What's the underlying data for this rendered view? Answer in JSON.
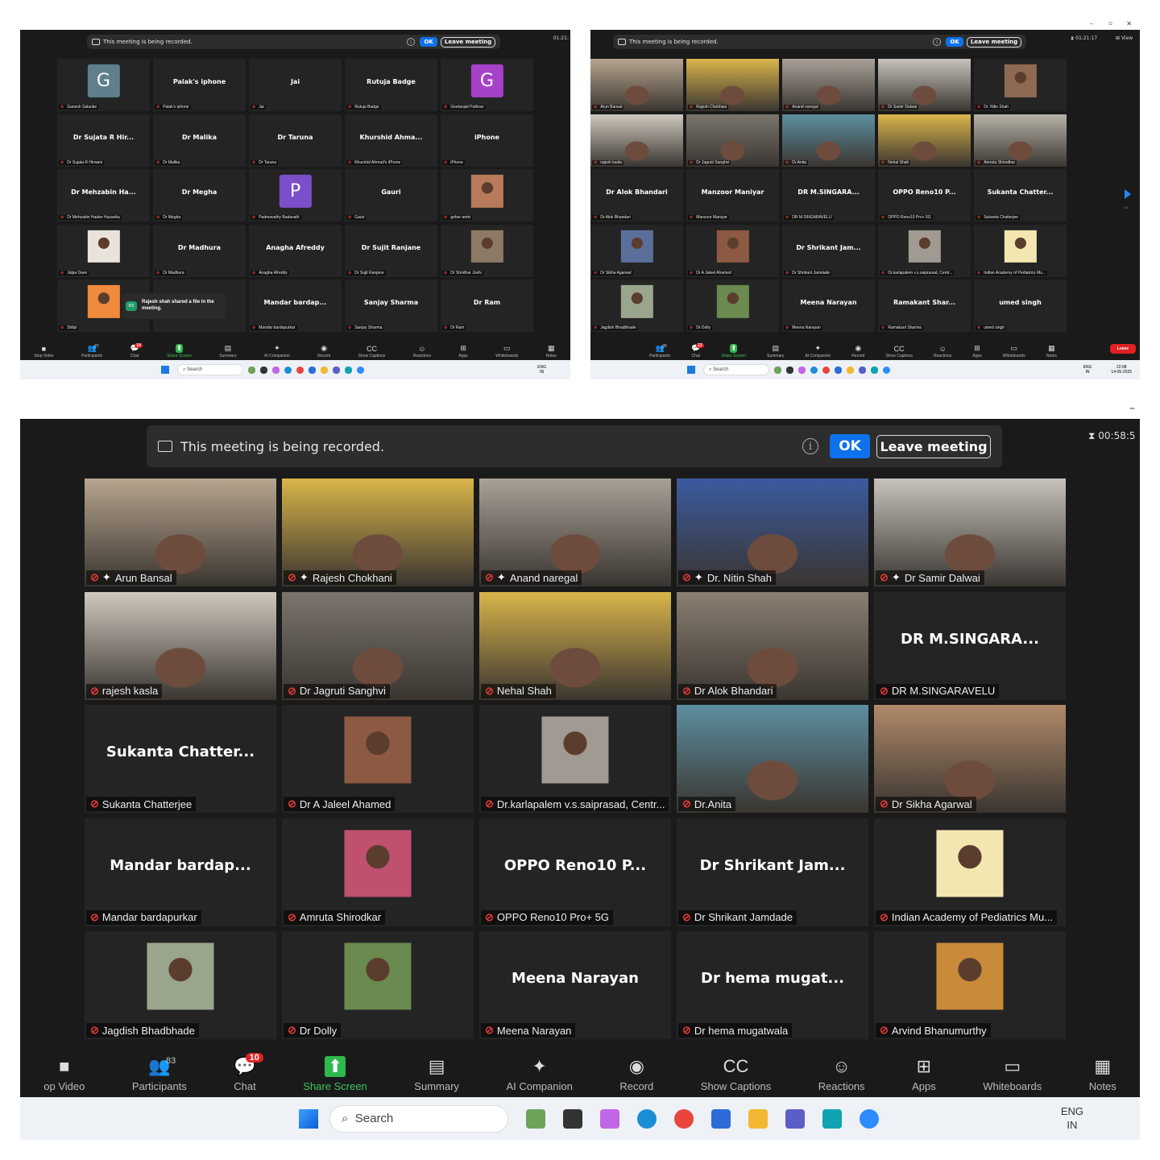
{
  "recording": {
    "message": "This meeting is being recorded.",
    "ok_label": "OK",
    "leave_label": "Leave meeting"
  },
  "screens": {
    "top_left": {
      "timer": "01:21:",
      "tiles": [
        {
          "kind": "avatar",
          "letter": "G",
          "color": "#5f7f8c",
          "name": "Ganesh Salunke"
        },
        {
          "kind": "text",
          "display": "Palak's iphone",
          "name": "Palak's iphone"
        },
        {
          "kind": "text",
          "display": "Jai",
          "name": "Jai"
        },
        {
          "kind": "text",
          "display": "Rutuja Badge",
          "name": "Rutuja Badge"
        },
        {
          "kind": "avatar",
          "letter": "G",
          "color": "#a542c8",
          "name": "Geetanjali Puthran"
        },
        {
          "kind": "text",
          "display": "Dr Sujata R Hir...",
          "name": "Dr Sujata R Hirwani"
        },
        {
          "kind": "text",
          "display": "Dr Malika",
          "name": "Dr Malika"
        },
        {
          "kind": "text",
          "display": "Dr Taruna",
          "name": "Dr Taruna"
        },
        {
          "kind": "text",
          "display": "Khurshid Ahma...",
          "name": "Khurshid Ahmad's iPhone"
        },
        {
          "kind": "text",
          "display": "iPhone",
          "name": "iPhone"
        },
        {
          "kind": "text",
          "display": "Dr Mehzabin Ha...",
          "name": "Dr Mehzabin Haider Hazarika"
        },
        {
          "kind": "text",
          "display": "Dr Megha",
          "name": "Dr Megha"
        },
        {
          "kind": "avatar",
          "letter": "P",
          "color": "#7b4fc9",
          "name": "Padmavathy Badavath"
        },
        {
          "kind": "text",
          "display": "Gauri",
          "name": "Gauri"
        },
        {
          "kind": "photo",
          "color": "#b87a5a",
          "name": "gohar amin"
        },
        {
          "kind": "photo",
          "color": "#e9e3dc",
          "name": "Jalpa Dave"
        },
        {
          "kind": "text",
          "display": "Dr Madhura",
          "name": "Dr Madhura"
        },
        {
          "kind": "text",
          "display": "Anagha Afreddy",
          "name": "Anagha Afreddy"
        },
        {
          "kind": "text",
          "display": "Dr Sujit Ranjane",
          "name": "Dr Sujit Ranjane"
        },
        {
          "kind": "photo",
          "color": "#8d7a66",
          "name": "Dr Shridhar Joshi"
        },
        {
          "kind": "photo",
          "color": "#f08a3c",
          "name": "Shilpi"
        },
        {
          "kind": "text",
          "display": "ll",
          "name": ""
        },
        {
          "kind": "text",
          "display": "Mandar bardap...",
          "name": "Mandar bardapurkar"
        },
        {
          "kind": "text",
          "display": "Sanjay Sharma",
          "name": "Sanjay Sharma"
        },
        {
          "kind": "text",
          "display": "Dr Ram",
          "name": "Dr Ram"
        }
      ],
      "toast": {
        "initials": "RS",
        "text": "Rajesh shah shared a file in the meeting."
      },
      "toolbar": [
        {
          "label": "Stop Video",
          "icon": "video-icon"
        },
        {
          "label": "Participants",
          "icon": "participants-icon",
          "count": "97"
        },
        {
          "label": "Chat",
          "icon": "chat-icon",
          "badge": "14"
        },
        {
          "label": "Share Screen",
          "icon": "share-screen-icon",
          "green": true
        },
        {
          "label": "Summary",
          "icon": "summary-icon"
        },
        {
          "label": "AI Companion",
          "icon": "ai-companion-icon"
        },
        {
          "label": "Record",
          "icon": "record-icon"
        },
        {
          "label": "Show Captions",
          "icon": "captions-icon"
        },
        {
          "label": "Reactions",
          "icon": "reactions-icon"
        },
        {
          "label": "Apps",
          "icon": "apps-icon"
        },
        {
          "label": "Whiteboards",
          "icon": "whiteboards-icon"
        },
        {
          "label": "Notes",
          "icon": "notes-icon"
        }
      ],
      "taskbar": {
        "search": "Search",
        "lang1": "ENG",
        "lang2": "IN"
      }
    },
    "top_right": {
      "timer": "01:21:17",
      "view_label": "View",
      "page_indicator": "1/4",
      "tiles": [
        {
          "kind": "video",
          "color": "#b7a58f",
          "name": "Arun Bansal"
        },
        {
          "kind": "video",
          "color": "#d9b54a",
          "name": "Rajesh Chokhani"
        },
        {
          "kind": "video",
          "color": "#a9a198",
          "name": "Anand naregal"
        },
        {
          "kind": "video",
          "color": "#c7c3bc",
          "name": "Dr Samir Dalwai"
        },
        {
          "kind": "photo",
          "color": "#8f6a52",
          "name": "Dr. Nitin Shah"
        },
        {
          "kind": "video",
          "color": "#cfc8be",
          "name": "rajesh kasla"
        },
        {
          "kind": "video",
          "color": "#7b756d",
          "name": "Dr Jagruti Sanghvi"
        },
        {
          "kind": "video",
          "color": "#5d8fa0",
          "name": "Dr.Anita"
        },
        {
          "kind": "video",
          "color": "#d9b54a",
          "name": "Nehal Shah"
        },
        {
          "kind": "video",
          "color": "#b8b3a8",
          "name": "Amruta Shirodkar"
        },
        {
          "kind": "text",
          "display": "Dr Alok Bhandari",
          "name": "Dr Alok Bhandari"
        },
        {
          "kind": "text",
          "display": "Manzoor Maniyar",
          "name": "Manzoor Maniyar"
        },
        {
          "kind": "text",
          "display": "DR M.SINGARA...",
          "name": "DR M.SINGARAVELU"
        },
        {
          "kind": "text",
          "display": "OPPO Reno10 P...",
          "name": "OPPO Reno10 Pro+ 5G"
        },
        {
          "kind": "text",
          "display": "Sukanta Chatter...",
          "name": "Sukanta Chatterjee"
        },
        {
          "kind": "photo",
          "color": "#5a6f9a",
          "name": "Dr Sikha Agarwal"
        },
        {
          "kind": "photo",
          "color": "#8c5a42",
          "name": "Dr A Jaleel Ahamed"
        },
        {
          "kind": "text",
          "display": "Dr Shrikant Jam...",
          "name": "Dr Shrikant Jamdade"
        },
        {
          "kind": "photo",
          "color": "#a09a92",
          "name": "Dr.karlapalem v.s.saiprasad, Centr..."
        },
        {
          "kind": "photo",
          "color": "#f4e6b0",
          "name": "Indian Academy of Pediatrics Mu..."
        },
        {
          "kind": "photo",
          "color": "#9aa58e",
          "name": "Jagdish Bhadbhade"
        },
        {
          "kind": "photo",
          "color": "#6a8a4f",
          "name": "Dr Dolly"
        },
        {
          "kind": "text",
          "display": "Meena Narayan",
          "name": "Meena Narayan"
        },
        {
          "kind": "text",
          "display": "Ramakant Shar...",
          "name": "Ramakant Sharma"
        },
        {
          "kind": "text",
          "display": "umed singh",
          "name": "umed singh"
        }
      ],
      "toolbar": [
        {
          "label": "Participants",
          "icon": "participants-icon",
          "count": "96"
        },
        {
          "label": "Chat",
          "icon": "chat-icon",
          "badge": "13"
        },
        {
          "label": "Share Screen",
          "icon": "share-screen-icon",
          "green": true
        },
        {
          "label": "Summary",
          "icon": "summary-icon"
        },
        {
          "label": "AI Companion",
          "icon": "ai-companion-icon"
        },
        {
          "label": "Record",
          "icon": "record-icon"
        },
        {
          "label": "Show Captions",
          "icon": "captions-icon"
        },
        {
          "label": "Reactions",
          "icon": "reactions-icon"
        },
        {
          "label": "Apps",
          "icon": "apps-icon"
        },
        {
          "label": "Whiteboards",
          "icon": "whiteboards-icon"
        },
        {
          "label": "Notes",
          "icon": "notes-icon"
        }
      ],
      "leave_label": "Leave",
      "taskbar": {
        "search": "Search",
        "lang1": "ENG",
        "lang2": "IN",
        "time": "22:08",
        "date": "14-05-2025"
      }
    },
    "bottom": {
      "timer": "00:58:5",
      "tiles": [
        {
          "kind": "video",
          "color": "#b7a58f",
          "name": "Arun Bansal",
          "pin": true
        },
        {
          "kind": "video",
          "color": "#d9b54a",
          "name": "Rajesh Chokhani",
          "pin": true
        },
        {
          "kind": "video",
          "color": "#a9a198",
          "name": "Anand naregal",
          "pin": true
        },
        {
          "kind": "video",
          "color": "#3b5aa0",
          "name": "Dr. Nitin Shah",
          "pin": true,
          "active": true
        },
        {
          "kind": "video",
          "color": "#c7c3bc",
          "name": "Dr Samir Dalwai",
          "pin": true
        },
        {
          "kind": "video",
          "color": "#cfc8be",
          "name": "rajesh kasla"
        },
        {
          "kind": "video",
          "color": "#7b756d",
          "name": "Dr Jagruti Sanghvi"
        },
        {
          "kind": "video",
          "color": "#d9b54a",
          "name": "Nehal Shah"
        },
        {
          "kind": "video",
          "color": "#8a7f72",
          "name": "Dr Alok Bhandari"
        },
        {
          "kind": "text",
          "display": "DR M.SINGARA...",
          "name": "DR M.SINGARAVELU"
        },
        {
          "kind": "text",
          "display": "Sukanta Chatter...",
          "name": "Sukanta Chatterjee"
        },
        {
          "kind": "photo",
          "color": "#8c5a42",
          "name": "Dr A Jaleel Ahamed"
        },
        {
          "kind": "photo",
          "color": "#a09a92",
          "name": "Dr.karlapalem v.s.saiprasad, Centr..."
        },
        {
          "kind": "video",
          "color": "#5d8fa0",
          "name": "Dr.Anita"
        },
        {
          "kind": "video",
          "color": "#b08a6a",
          "name": "Dr Sikha Agarwal"
        },
        {
          "kind": "text",
          "display": "Mandar bardap...",
          "name": "Mandar bardapurkar"
        },
        {
          "kind": "photo",
          "color": "#c0506e",
          "name": "Amruta Shirodkar"
        },
        {
          "kind": "text",
          "display": "OPPO Reno10 P...",
          "name": "OPPO Reno10 Pro+ 5G"
        },
        {
          "kind": "text",
          "display": "Dr Shrikant Jam...",
          "name": "Dr Shrikant Jamdade"
        },
        {
          "kind": "photo",
          "color": "#f4e6b0",
          "name": "Indian Academy of Pediatrics Mu..."
        },
        {
          "kind": "photo",
          "color": "#9aa58e",
          "name": "Jagdish Bhadbhade"
        },
        {
          "kind": "photo",
          "color": "#6a8a4f",
          "name": "Dr Dolly"
        },
        {
          "kind": "text",
          "display": "Meena Narayan",
          "name": "Meena Narayan"
        },
        {
          "kind": "text",
          "display": "Dr hema mugat...",
          "name": "Dr hema mugatwala"
        },
        {
          "kind": "photo",
          "color": "#c98a3a",
          "name": "Arvind Bhanumurthy"
        }
      ],
      "toolbar": [
        {
          "label": "op Video",
          "icon": "video-icon"
        },
        {
          "label": "Participants",
          "icon": "participants-icon",
          "count": "83"
        },
        {
          "label": "Chat",
          "icon": "chat-icon",
          "badge": "10"
        },
        {
          "label": "Share Screen",
          "icon": "share-screen-icon",
          "green": true
        },
        {
          "label": "Summary",
          "icon": "summary-icon"
        },
        {
          "label": "AI Companion",
          "icon": "ai-companion-icon"
        },
        {
          "label": "Record",
          "icon": "record-icon"
        },
        {
          "label": "Show Captions",
          "icon": "captions-icon"
        },
        {
          "label": "Reactions",
          "icon": "reactions-icon"
        },
        {
          "label": "Apps",
          "icon": "apps-icon"
        },
        {
          "label": "Whiteboards",
          "icon": "whiteboards-icon"
        },
        {
          "label": "Notes",
          "icon": "notes-icon"
        }
      ],
      "taskbar": {
        "search": "Search",
        "lang1": "ENG",
        "lang2": "IN"
      }
    }
  }
}
